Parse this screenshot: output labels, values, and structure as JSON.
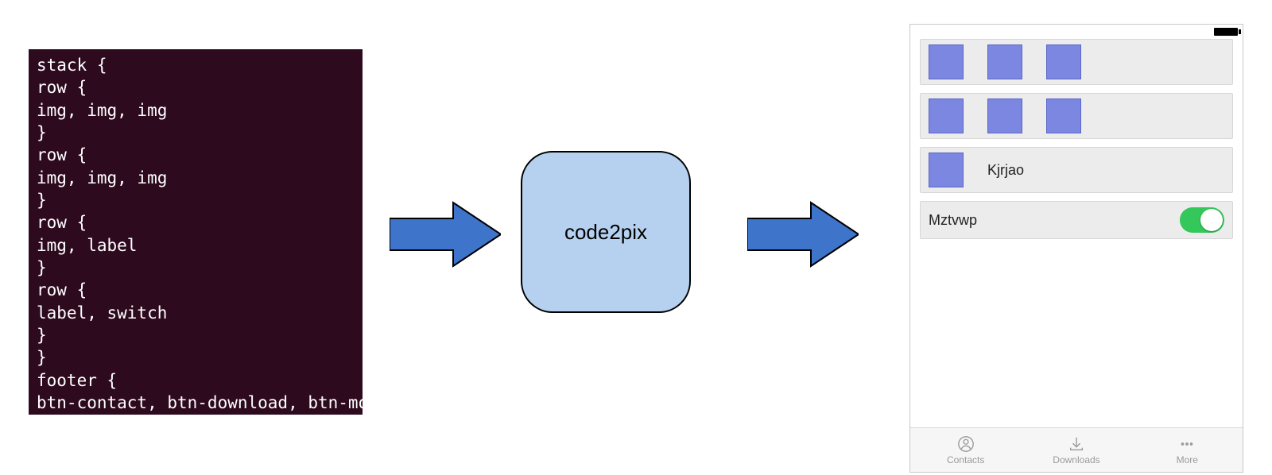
{
  "code_block": "stack {\nrow {\nimg, img, img\n}\nrow {\nimg, img, img\n}\nrow {\nimg, label\n}\nrow {\nlabel, switch\n}\n}\nfooter {\nbtn-contact, btn-download, btn-more\n}",
  "center": {
    "label": "code2pix"
  },
  "phone": {
    "rows": [
      {
        "type": "images3"
      },
      {
        "type": "images3"
      },
      {
        "type": "image_label",
        "label": "Kjrjao"
      },
      {
        "type": "label_switch",
        "label": "Mztvwp",
        "switch_on": true
      }
    ],
    "footer": [
      {
        "icon": "contacts",
        "label": "Contacts"
      },
      {
        "icon": "download",
        "label": "Downloads"
      },
      {
        "icon": "more",
        "label": "More"
      }
    ]
  },
  "colors": {
    "code_bg": "#2d0a1e",
    "arrow_fill": "#3e74c9",
    "center_fill": "#b5d1ef",
    "img_fill": "#7b87e0",
    "toggle_on": "#34c759"
  }
}
